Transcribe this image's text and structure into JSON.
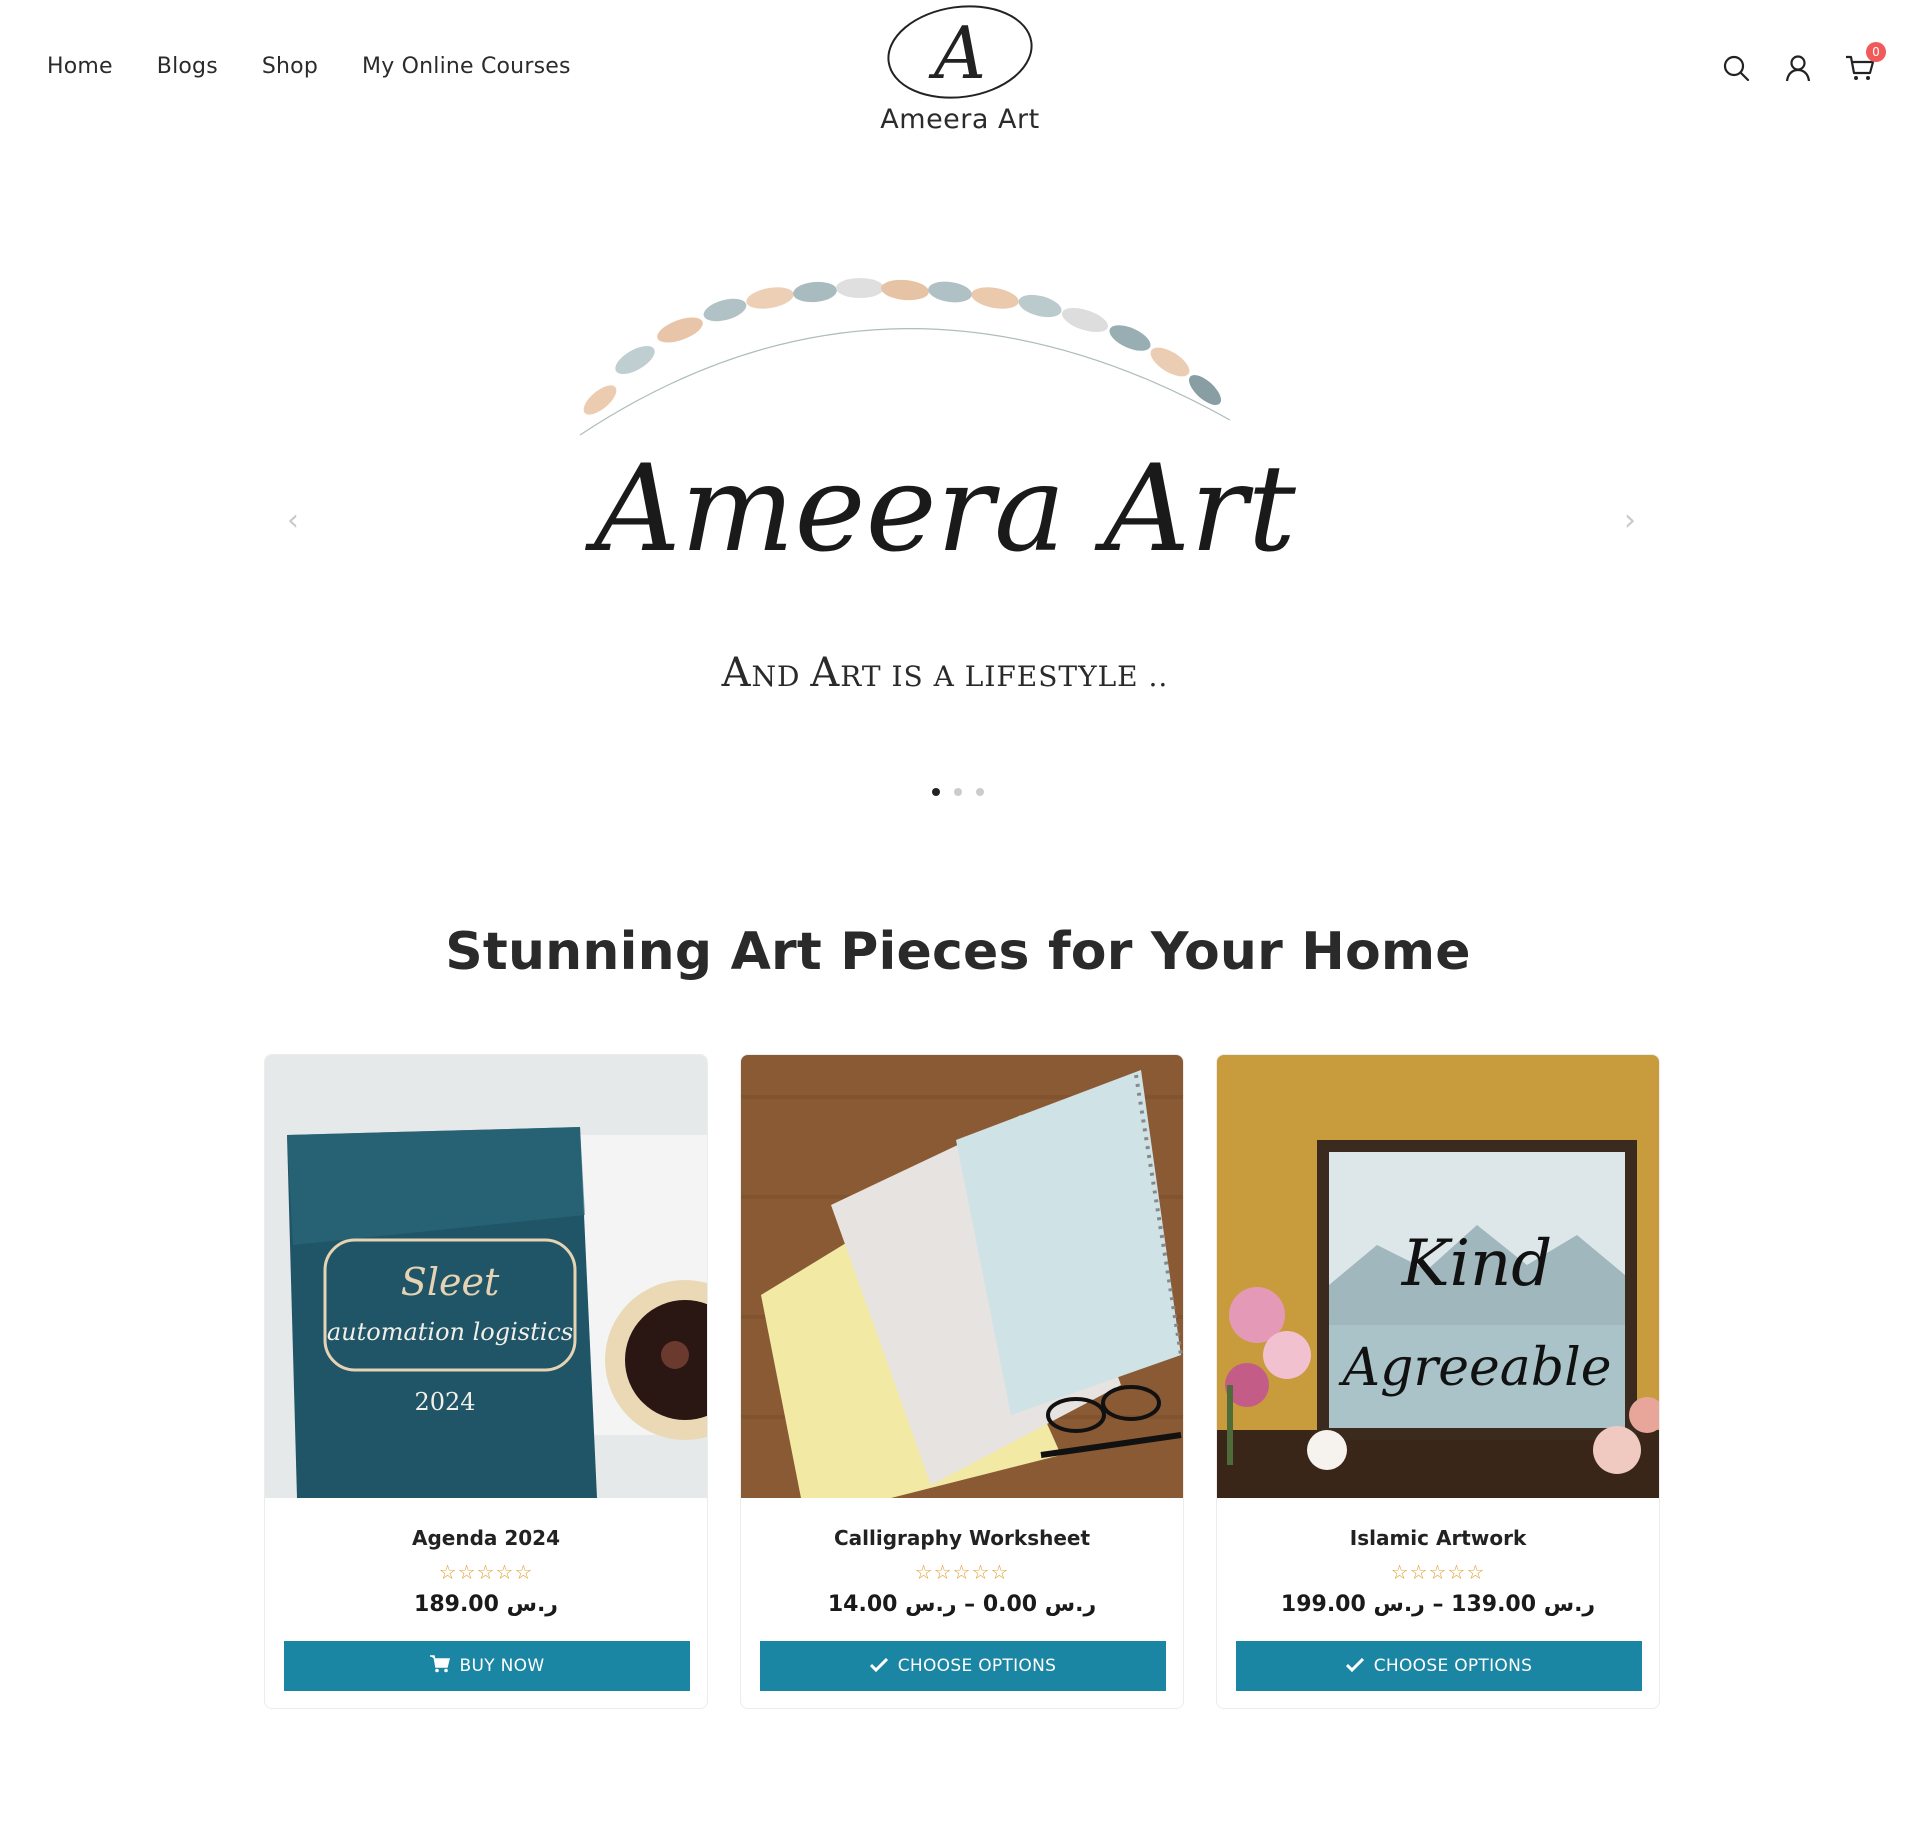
{
  "nav": {
    "items": [
      {
        "label": "Home"
      },
      {
        "label": "Blogs"
      },
      {
        "label": "Shop"
      },
      {
        "label": "My Online Courses"
      }
    ]
  },
  "brand": {
    "name": "Ameera Art",
    "monogram": "A"
  },
  "header_icons": {
    "search": "search-icon",
    "account": "user-icon",
    "cart": "cart-icon",
    "cart_count": "0"
  },
  "hero": {
    "title": "Ameera Art",
    "tagline_a": "A",
    "tagline_b": "ND ",
    "tagline_c": "A",
    "tagline_d": "RT IS A LIFESTYLE ..",
    "slides_count": 3,
    "active_slide": 1,
    "prev_arrow": "‹",
    "next_arrow": "›"
  },
  "section": {
    "title": "Stunning Art Pieces for Your Home"
  },
  "products": [
    {
      "title": "Agenda 2024",
      "stars": "☆☆☆☆☆",
      "price": "ر.س 189.00",
      "button": "BUY NOW",
      "button_icon": "cart-icon",
      "image_text_a": "Sleet",
      "image_text_b": "automation logistics",
      "image_text_c": "2024"
    },
    {
      "title": "Calligraphy Worksheet",
      "stars": "☆☆☆☆☆",
      "price": "ر.س 0.00 – ر.س 14.00",
      "button": "CHOOSE OPTIONS",
      "button_icon": "check-icon"
    },
    {
      "title": "Islamic Artwork",
      "stars": "☆☆☆☆☆",
      "price": "ر.س 139.00 – ر.س 199.00",
      "button": "CHOOSE OPTIONS",
      "button_icon": "check-icon",
      "image_text_a": "Kind",
      "image_text_b": "Agreeable"
    }
  ],
  "colors": {
    "accent": "#1a86a3",
    "badge": "#f05a5a",
    "star": "#e0a336"
  }
}
